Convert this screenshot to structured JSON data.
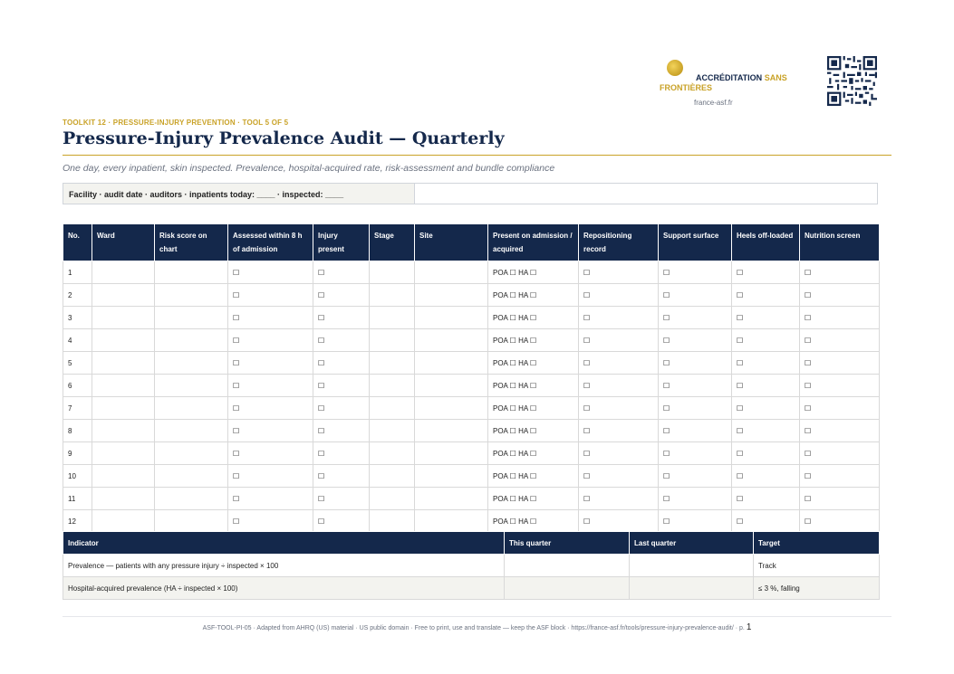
{
  "brand": {
    "name_dark": "ACCRÉDITATION",
    "name_gold_1": "SANS",
    "name_gold_2": "FRONTIÈRES",
    "url": "france-asf.fr"
  },
  "header": {
    "kicker": "TOOLKIT 12 · PRESSURE-INJURY PREVENTION · TOOL 5 OF 5",
    "title": "Pressure-Injury Prevalence Audit — Quarterly",
    "subtitle": "One day, every inpatient, skin inspected. Prevalence, hospital-acquired rate, risk-assessment and bundle compliance"
  },
  "facility_label": "Facility · audit date · auditors · inpatients today: ____ · inspected: ____",
  "audit_table": {
    "columns": [
      "No.",
      "Ward",
      "Risk score on chart",
      "Assessed within 8 h of admission",
      "Injury present",
      "Stage",
      "Site",
      "Present on admission / acquired",
      "Repositioning record",
      "Support surface",
      "Heels off-loaded",
      "Nutrition screen"
    ],
    "rows": [
      {
        "no": "1",
        "ward": "",
        "risk": "",
        "assessed": "☐",
        "injury": "☐",
        "stage": "",
        "site": "",
        "poa": "POA ☐ HA ☐",
        "repos": "☐",
        "support": "☐",
        "heels": "☐",
        "nutrition": "☐"
      },
      {
        "no": "2",
        "ward": "",
        "risk": "",
        "assessed": "☐",
        "injury": "☐",
        "stage": "",
        "site": "",
        "poa": "POA ☐ HA ☐",
        "repos": "☐",
        "support": "☐",
        "heels": "☐",
        "nutrition": "☐"
      },
      {
        "no": "3",
        "ward": "",
        "risk": "",
        "assessed": "☐",
        "injury": "☐",
        "stage": "",
        "site": "",
        "poa": "POA ☐ HA ☐",
        "repos": "☐",
        "support": "☐",
        "heels": "☐",
        "nutrition": "☐"
      },
      {
        "no": "4",
        "ward": "",
        "risk": "",
        "assessed": "☐",
        "injury": "☐",
        "stage": "",
        "site": "",
        "poa": "POA ☐ HA ☐",
        "repos": "☐",
        "support": "☐",
        "heels": "☐",
        "nutrition": "☐"
      },
      {
        "no": "5",
        "ward": "",
        "risk": "",
        "assessed": "☐",
        "injury": "☐",
        "stage": "",
        "site": "",
        "poa": "POA ☐ HA ☐",
        "repos": "☐",
        "support": "☐",
        "heels": "☐",
        "nutrition": "☐"
      },
      {
        "no": "6",
        "ward": "",
        "risk": "",
        "assessed": "☐",
        "injury": "☐",
        "stage": "",
        "site": "",
        "poa": "POA ☐ HA ☐",
        "repos": "☐",
        "support": "☐",
        "heels": "☐",
        "nutrition": "☐"
      },
      {
        "no": "7",
        "ward": "",
        "risk": "",
        "assessed": "☐",
        "injury": "☐",
        "stage": "",
        "site": "",
        "poa": "POA ☐ HA ☐",
        "repos": "☐",
        "support": "☐",
        "heels": "☐",
        "nutrition": "☐"
      },
      {
        "no": "8",
        "ward": "",
        "risk": "",
        "assessed": "☐",
        "injury": "☐",
        "stage": "",
        "site": "",
        "poa": "POA ☐ HA ☐",
        "repos": "☐",
        "support": "☐",
        "heels": "☐",
        "nutrition": "☐"
      },
      {
        "no": "9",
        "ward": "",
        "risk": "",
        "assessed": "☐",
        "injury": "☐",
        "stage": "",
        "site": "",
        "poa": "POA ☐ HA ☐",
        "repos": "☐",
        "support": "☐",
        "heels": "☐",
        "nutrition": "☐"
      },
      {
        "no": "10",
        "ward": "",
        "risk": "",
        "assessed": "☐",
        "injury": "☐",
        "stage": "",
        "site": "",
        "poa": "POA ☐ HA ☐",
        "repos": "☐",
        "support": "☐",
        "heels": "☐",
        "nutrition": "☐"
      },
      {
        "no": "11",
        "ward": "",
        "risk": "",
        "assessed": "☐",
        "injury": "☐",
        "stage": "",
        "site": "",
        "poa": "POA ☐ HA ☐",
        "repos": "☐",
        "support": "☐",
        "heels": "☐",
        "nutrition": "☐"
      },
      {
        "no": "12",
        "ward": "",
        "risk": "",
        "assessed": "☐",
        "injury": "☐",
        "stage": "",
        "site": "",
        "poa": "POA ☐ HA ☐",
        "repos": "☐",
        "support": "☐",
        "heels": "☐",
        "nutrition": "☐"
      }
    ]
  },
  "indicator_table": {
    "columns": [
      "Indicator",
      "This quarter",
      "Last quarter",
      "Target"
    ],
    "rows": [
      {
        "indicator": "Prevalence — patients with any pressure injury ÷ inspected × 100",
        "this": "",
        "last": "",
        "target": "Track"
      },
      {
        "indicator": "Hospital-acquired prevalence (HA ÷ inspected × 100)",
        "this": "",
        "last": "",
        "target": "≤ 3 %, falling"
      }
    ]
  },
  "footer": {
    "text": "ASF-TOOL-PI-05  ·  Adapted from AHRQ (US) material  ·  US public domain  ·  Free to print, use and translate — keep the ASF block  ·  https://france-asf.fr/tools/pressure-injury-prevalence-audit/  ·  p.",
    "page": "1"
  },
  "colors": {
    "navy": "#14284b",
    "gold": "#c9a227",
    "muted": "#6b7280"
  },
  "icons": {
    "logo": "asf-logo-icon",
    "qr": "qr-code-icon"
  }
}
